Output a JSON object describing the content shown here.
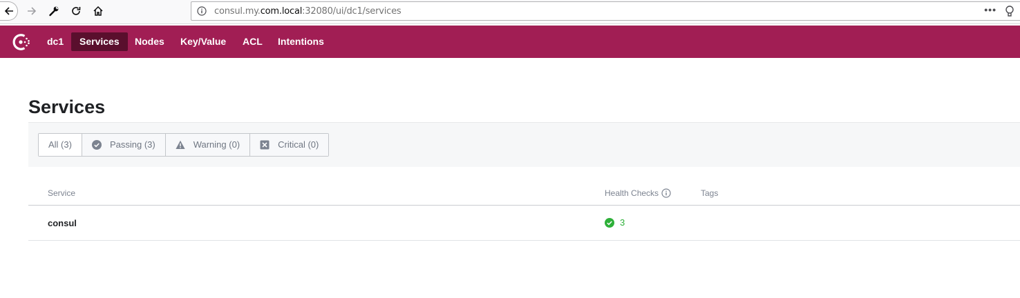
{
  "browser": {
    "url_prefix": "consul.my.",
    "url_domain": "com.local",
    "url_suffix": ":32080/ui/dc1/services",
    "more_label": "•••"
  },
  "nav": {
    "datacenter": "dc1",
    "items": [
      {
        "label": "Services",
        "active": true
      },
      {
        "label": "Nodes",
        "active": false
      },
      {
        "label": "Key/Value",
        "active": false
      },
      {
        "label": "ACL",
        "active": false
      },
      {
        "label": "Intentions",
        "active": false
      }
    ]
  },
  "page": {
    "title": "Services",
    "filters": [
      {
        "label": "All (3)",
        "icon": "none"
      },
      {
        "label": "Passing (3)",
        "icon": "check-circle-icon"
      },
      {
        "label": "Warning (0)",
        "icon": "warning-triangle-icon"
      },
      {
        "label": "Critical (0)",
        "icon": "x-square-icon"
      }
    ],
    "table": {
      "headers": {
        "service": "Service",
        "health": "Health Checks",
        "tags": "Tags"
      },
      "rows": [
        {
          "service": "consul",
          "health_passing": "3",
          "tags": ""
        }
      ]
    }
  },
  "colors": {
    "brand": "#a11e54",
    "nav_active": "#5a0f2d",
    "passing": "#2eb039"
  }
}
